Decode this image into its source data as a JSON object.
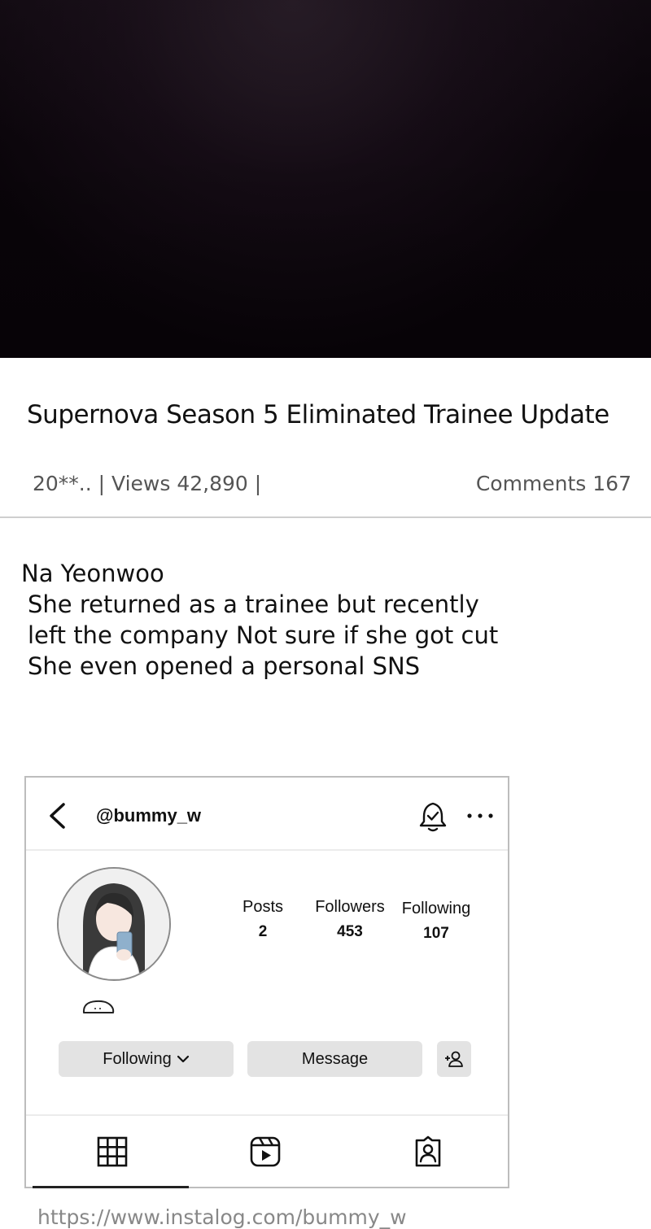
{
  "post": {
    "title": "Supernova Season 5 Eliminated Trainee Update",
    "meta_left": "20**.. | Views 42,890 |",
    "meta_right": "Comments 167"
  },
  "body": {
    "lines": [
      "Na Yeonwoo",
      "She returned as a trainee but recently",
      "left the company  Not sure if she got cut",
      "She even opened a personal SNS"
    ]
  },
  "instagram": {
    "handle": "@bummy_w",
    "stats": {
      "posts_label": "Posts",
      "posts_value": "2",
      "followers_label": "Followers",
      "followers_value": "453",
      "following_label": "Following",
      "following_value": "107"
    },
    "buttons": {
      "following": "Following",
      "message": "Message"
    },
    "icons": [
      "back-icon",
      "notification-bell-icon",
      "more-icon",
      "add-user-icon",
      "grid-icon",
      "reels-icon",
      "tagged-icon"
    ]
  },
  "source_url": "https://www.instalog.com/bummy_w"
}
